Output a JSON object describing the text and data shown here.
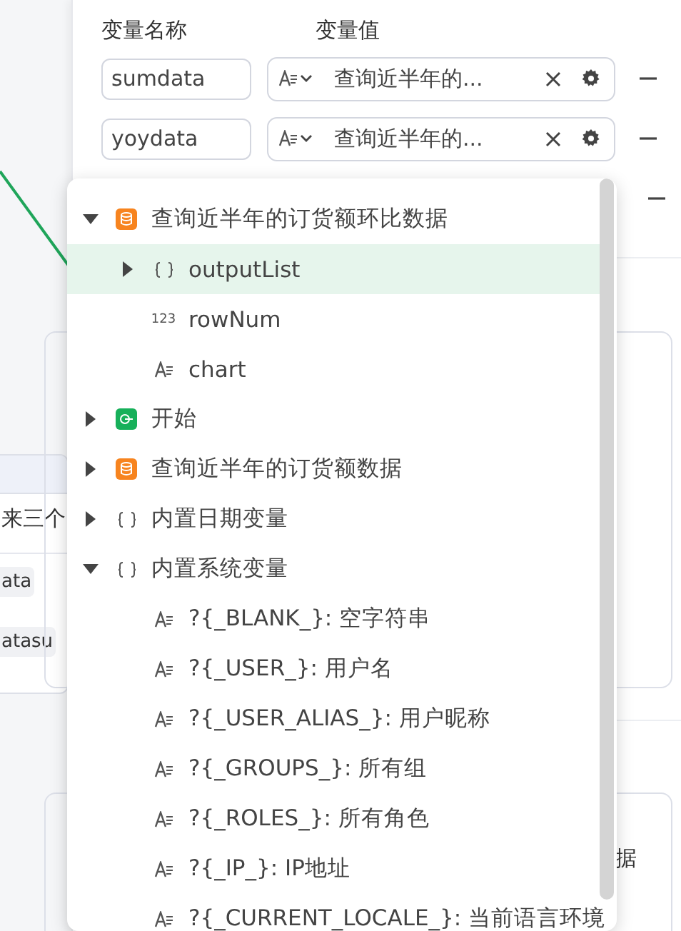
{
  "canvas": {
    "card": {
      "title": "来三个",
      "chips": [
        "ata",
        "atasu"
      ]
    }
  },
  "panel": {
    "headers": [
      "变量名称",
      "变量值"
    ],
    "variables": [
      {
        "kind": "full",
        "name": "sumdata",
        "value": "查询近半年的..."
      },
      {
        "kind": "full",
        "name": "yoydata",
        "value": "查询近半年的..."
      },
      {
        "kind": "covered"
      }
    ],
    "lower_card_text": "据"
  },
  "dropdown": {
    "tree": [
      {
        "label": "查询近半年的订货额环比数据",
        "kind": "query",
        "expanded": true,
        "selected": false,
        "children": [
          {
            "label": "outputList",
            "kind": "object",
            "expanded": false,
            "selected": true
          },
          {
            "label": "rowNum",
            "kind": "number",
            "type_label": "123",
            "selected": false
          },
          {
            "label": "chart",
            "kind": "text",
            "selected": false
          }
        ]
      },
      {
        "label": "开始",
        "kind": "start",
        "expanded": false,
        "selected": false
      },
      {
        "label": "查询近半年的订货额数据",
        "kind": "query",
        "expanded": false,
        "selected": false
      },
      {
        "label": "内置日期变量",
        "kind": "object",
        "expanded": false,
        "selected": false
      },
      {
        "label": "内置系统变量",
        "kind": "object",
        "expanded": true,
        "selected": false,
        "children": [
          {
            "label": "?{_BLANK_}: 空字符串",
            "kind": "text",
            "selected": false
          },
          {
            "label": "?{_USER_}: 用户名",
            "kind": "text",
            "selected": false
          },
          {
            "label": "?{_USER_ALIAS_}: 用户昵称",
            "kind": "text",
            "selected": false
          },
          {
            "label": "?{_GROUPS_}: 所有组",
            "kind": "text",
            "selected": false
          },
          {
            "label": "?{_ROLES_}: 所有角色",
            "kind": "text",
            "selected": false
          },
          {
            "label": "?{_IP_}: IP地址",
            "kind": "text",
            "selected": false
          },
          {
            "label": "?{_CURRENT_LOCALE_}: 当前语言环境",
            "kind": "text",
            "selected": false
          }
        ]
      }
    ]
  }
}
